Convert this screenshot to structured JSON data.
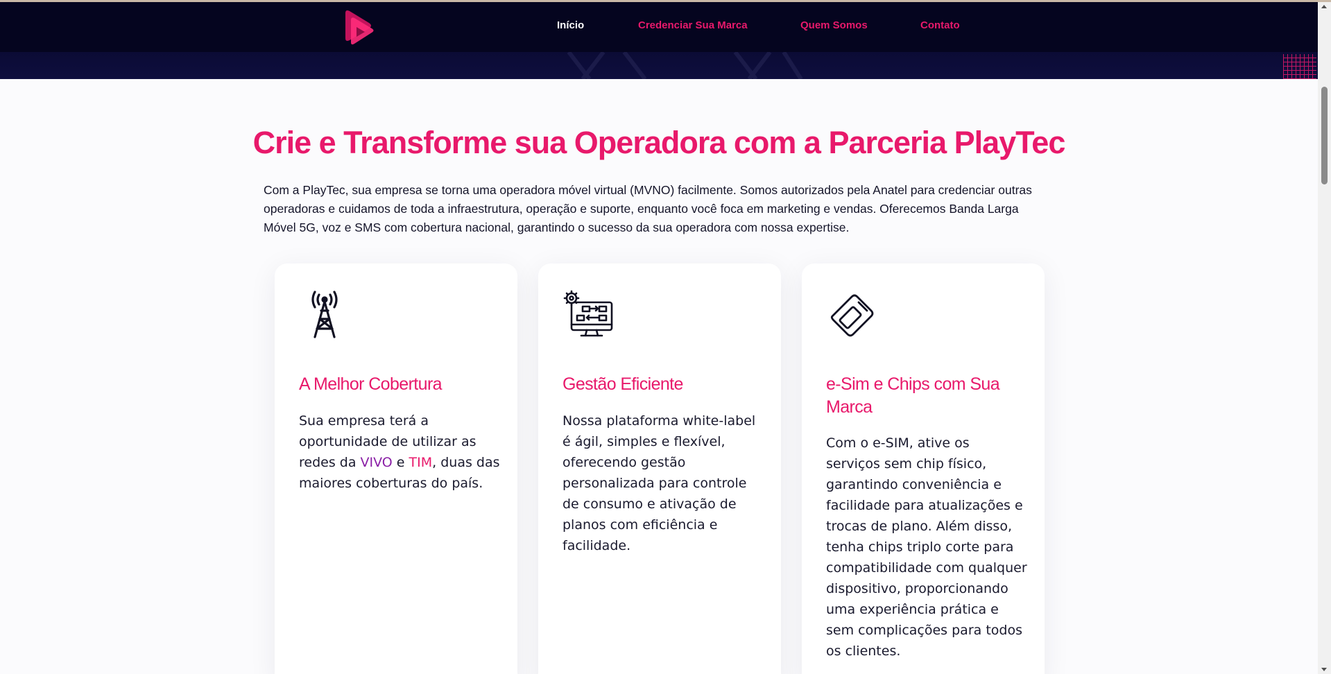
{
  "brand": {
    "accent": "#e8196b",
    "header_bg": "#05051f"
  },
  "header": {
    "logo": "playtec-play-logo",
    "nav": [
      {
        "label": "Início",
        "active": true
      },
      {
        "label": "Credenciar Sua Marca",
        "active": false
      },
      {
        "label": "Quem Somos",
        "active": false
      },
      {
        "label": "Contato",
        "active": false
      }
    ]
  },
  "main": {
    "title": "Crie e Transforme sua Operadora com a Parceria PlayTec",
    "intro": "Com a PlayTec, sua empresa se torna uma operadora móvel virtual (MVNO) facilmente. Somos autorizados pela Anatel para credenciar outras operadoras e cuidamos de toda a infraestrutura, operação e suporte, enquanto você foca em marketing e vendas. Oferecemos Banda Larga Móvel 5G, voz e SMS com cobertura nacional, garantindo o sucesso da sua operadora com nossa expertise.",
    "cards": [
      {
        "icon": "cell-tower-icon",
        "title": "A Melhor Cobertura",
        "text_before": "Sua empresa terá a oportunidade de utilizar as redes da ",
        "vivo": "VIVO",
        "and": " e ",
        "tim": "TIM",
        "text_after": ", duas das maiores coberturas do país."
      },
      {
        "icon": "monitor-gear-icon",
        "title": "Gestão Eficiente",
        "text": "Nossa plataforma white-label é ágil, simples e flexível, oferecendo gestão personalizada para controle de consumo e ativação de planos com eficiência e facilidade."
      },
      {
        "icon": "sim-card-icon",
        "title": "e-Sim e Chips com Sua Marca",
        "text": "Com o e-SIM, ative os serviços sem chip físico, garantindo conveniência e facilidade para atualizações e trocas de plano. Além disso, tenha chips triplo corte para compatibilidade com qualquer dispositivo, proporcionando uma experiência prática e sem complicações para todos os clientes."
      }
    ]
  }
}
